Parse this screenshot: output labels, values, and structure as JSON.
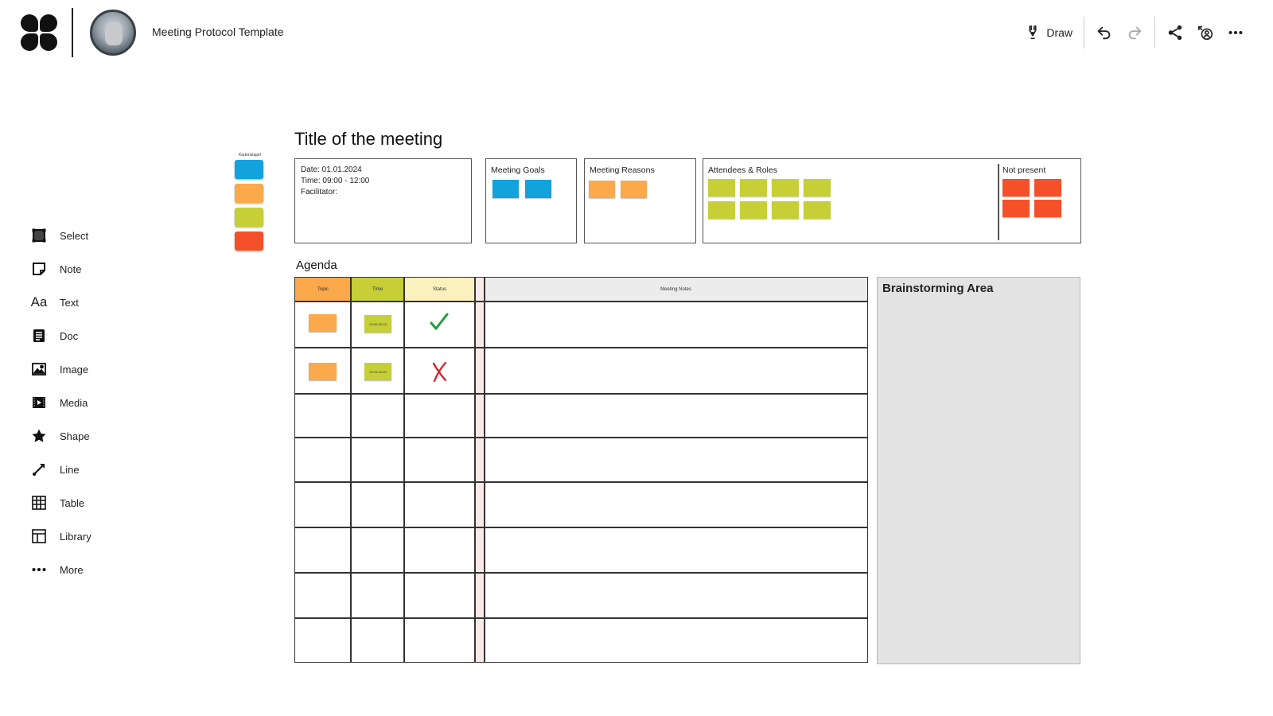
{
  "app": {
    "doc_title": "Meeting Protocol Template"
  },
  "topbar": {
    "draw_label": "Draw"
  },
  "tools": [
    {
      "label": "Select",
      "icon": "select-icon"
    },
    {
      "label": "Note",
      "icon": "note-icon"
    },
    {
      "label": "Text",
      "icon": "text-icon",
      "glyph": "Aa"
    },
    {
      "label": "Doc",
      "icon": "doc-icon"
    },
    {
      "label": "Image",
      "icon": "image-icon"
    },
    {
      "label": "Media",
      "icon": "media-icon"
    },
    {
      "label": "Shape",
      "icon": "star-icon"
    },
    {
      "label": "Line",
      "icon": "line-icon"
    },
    {
      "label": "Table",
      "icon": "table-icon"
    },
    {
      "label": "Library",
      "icon": "library-icon"
    },
    {
      "label": "More",
      "icon": "more-icon"
    }
  ],
  "card_stack": {
    "label": "Kartenstapel",
    "colors": [
      "#12a3dc",
      "#fba94a",
      "#c6cf35",
      "#f4512a"
    ]
  },
  "board": {
    "title": "Title of the meeting",
    "info": {
      "date": "Date:  01.01.2024",
      "time": "Time:  09:00 - 12:00",
      "facilitator": "Facilitator:"
    },
    "goals_label": "Meeting Goals",
    "reasons_label": "Meeting Reasons",
    "attendees_label": "Attendees & Roles",
    "not_present_label": "Not present",
    "colors": {
      "blue": "#12a3dc",
      "orange": "#fba94a",
      "lime": "#c6cf35",
      "red": "#f4512a"
    }
  },
  "agenda": {
    "title": "Agenda",
    "headers": {
      "topic": "Topic",
      "time": "Time",
      "status": "Status",
      "notes": "Meeting Notes"
    },
    "rows": [
      {
        "time": "09:00-09:15",
        "status": "done"
      },
      {
        "time": "09:15-10:00",
        "status": "not-done"
      }
    ]
  },
  "brainstorm": {
    "title": "Brainstorming Area"
  }
}
